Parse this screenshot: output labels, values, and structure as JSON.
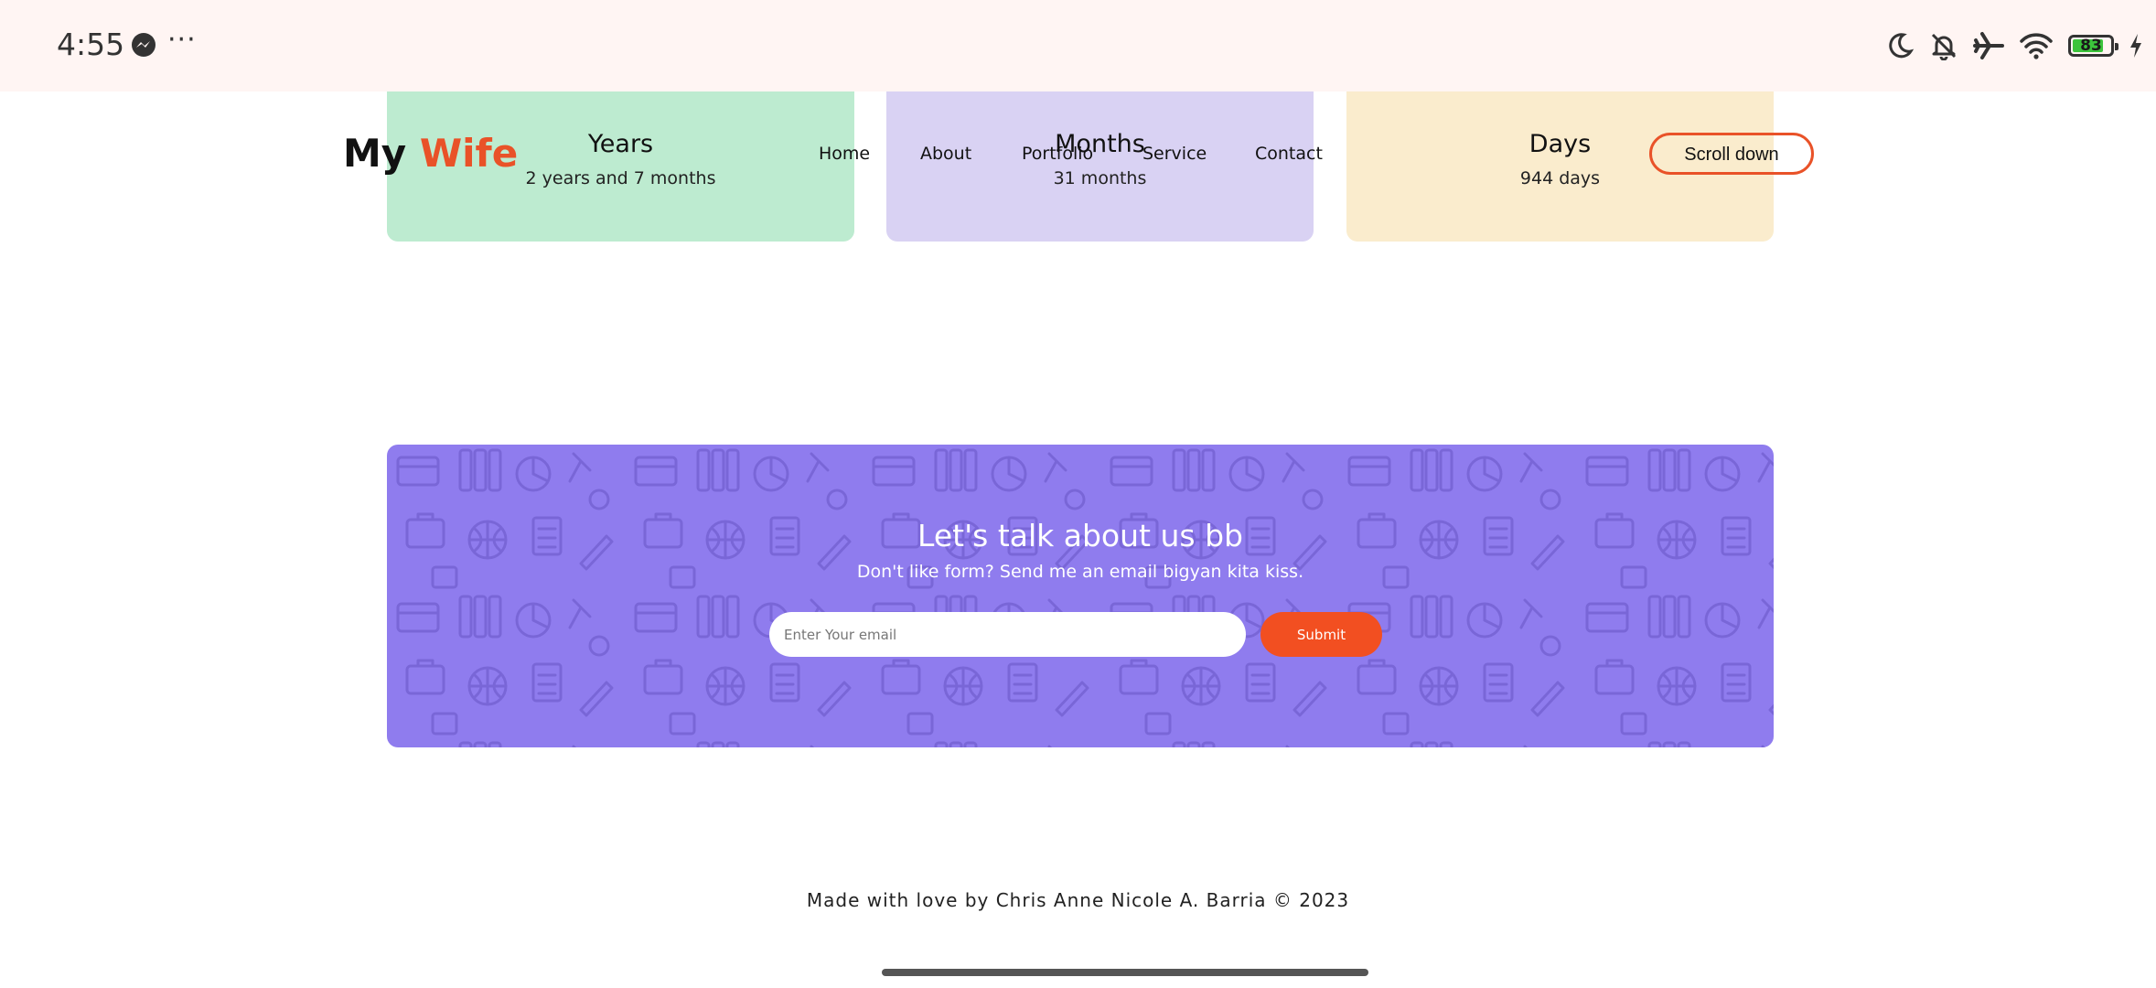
{
  "status_bar": {
    "time": "4:55",
    "overflow": "···",
    "battery_level": "83",
    "battery_percent": 83,
    "icons": [
      "messenger-icon",
      "moon-icon",
      "bell-off-icon",
      "airplane-icon",
      "wifi-icon",
      "battery-icon",
      "charging-icon"
    ]
  },
  "header": {
    "logo_text": "My",
    "logo_accent": "Wife",
    "nav": [
      "Home",
      "About",
      "Portfolio",
      "Service",
      "Contact"
    ],
    "cta_label": "Scroll down"
  },
  "stats": [
    {
      "title": "Years",
      "value": "2 years and 7 months",
      "color": "#bdebd0"
    },
    {
      "title": "Months",
      "value": "31 months",
      "color": "#d9d2f3"
    },
    {
      "title": "Days",
      "value": "944 days",
      "color": "#faeccd"
    }
  ],
  "contact": {
    "title": "Let's talk about us bb",
    "subtitle": "Don't like form? Send me an email bigyan kita kiss.",
    "email_placeholder": "Enter Your email",
    "submit_label": "Submit",
    "background": "#8f7cee",
    "button_color": "#f24f21"
  },
  "footer": {
    "text": "Made with love by Chris Anne Nicole A. Barria © 2023"
  },
  "colors": {
    "accent": "#e95228",
    "status_bar_bg": "#fff5f3"
  }
}
